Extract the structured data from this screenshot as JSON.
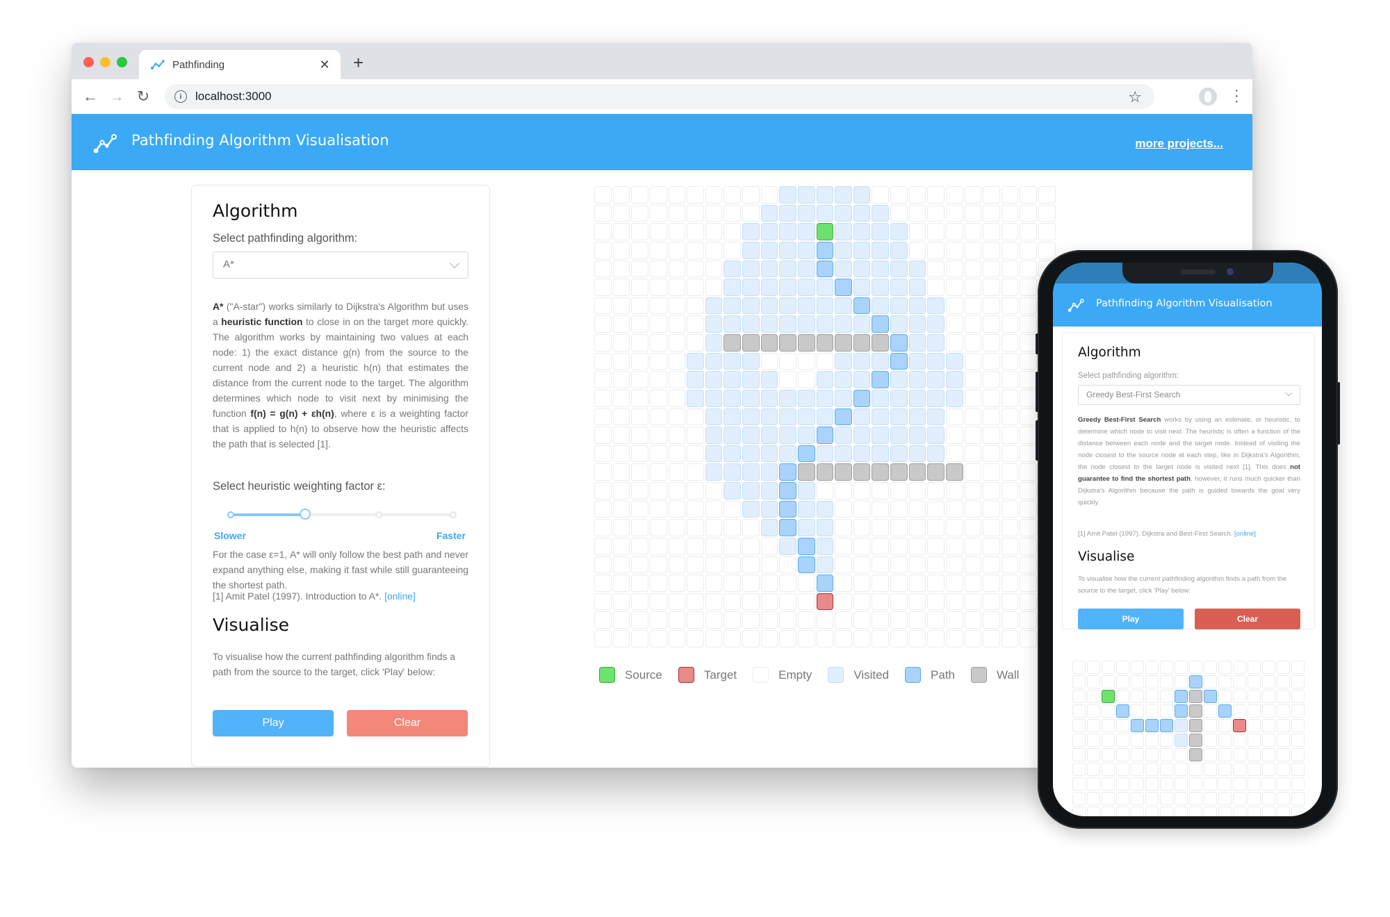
{
  "browser": {
    "tab_title": "Pathfinding",
    "url": "localhost:3000",
    "icons": {
      "back": "arrow-left-icon",
      "forward": "arrow-right-icon",
      "reload": "reload-icon",
      "info": "info-icon",
      "bookmark": "star-icon",
      "profile": "avatar-icon",
      "menu": "kebab-menu-icon",
      "close_tab": "close-icon",
      "new_tab": "plus-icon"
    }
  },
  "header": {
    "title": "Pathfinding Algorithm Visualisation",
    "more_link": "more projects...",
    "brand_color": "#3ba9f5"
  },
  "panel": {
    "algorithm_heading": "Algorithm",
    "select_label": "Select pathfinding algorithm:",
    "selected_algorithm": "A*",
    "description": {
      "bold_name": "A*",
      "part1": " (\"A-star\") works similarly to Dijkstra's Algorithm but uses a ",
      "bold_heuristic": "heuristic function",
      "part2": " to close in on the target more quickly. The algorithm works by maintaining two values at each node: 1) the exact distance g(n) from the source to the current node and 2) a heuristic h(n) that estimates the distance from the current node to the target. The algorithm determines which node to visit next by minimising the function ",
      "bold_formula": "f(n) = g(n) + εh(n)",
      "part3": ", where ε is a weighting factor that is applied to h(n) to observe how the heuristic affects the path that is selected [1]."
    },
    "epsilon_label": "Select heuristic weighting factor ε:",
    "slider": {
      "steps": 4,
      "current_step_index": 1,
      "value_fraction": 0.3333,
      "min_label": "Slower",
      "max_label": "Faster"
    },
    "epsilon_note": "For the case ε=1, A* will only follow the best path and never expand anything else, making it fast while still guaranteeing the shortest path.",
    "reference": "[1] Amit Patel (1997). Introduction to A*. ",
    "reference_link": "[online]",
    "visualise_heading": "Visualise",
    "visualise_desc": "To visualise how the current pathfinding algorithm finds a path from the source to the target, click 'Play' below:",
    "play_label": "Play",
    "clear_label": "Clear"
  },
  "grid": {
    "cols": 25,
    "rows": 25,
    "source": [
      2,
      12
    ],
    "target": [
      22,
      12
    ],
    "visited_ranges": [
      [
        0,
        10,
        14
      ],
      [
        1,
        9,
        15
      ],
      [
        2,
        8,
        16
      ],
      [
        3,
        8,
        16
      ],
      [
        4,
        7,
        17
      ],
      [
        5,
        7,
        17
      ],
      [
        6,
        6,
        18
      ],
      [
        7,
        6,
        18
      ],
      [
        8,
        6,
        6
      ],
      [
        8,
        17,
        18
      ],
      [
        9,
        5,
        8
      ],
      [
        9,
        13,
        15
      ],
      [
        9,
        17,
        19
      ],
      [
        10,
        5,
        9
      ],
      [
        10,
        12,
        14
      ],
      [
        10,
        16,
        19
      ],
      [
        11,
        5,
        19
      ],
      [
        12,
        6,
        18
      ],
      [
        13,
        6,
        18
      ],
      [
        14,
        6,
        18
      ],
      [
        15,
        6,
        9
      ],
      [
        16,
        7,
        9
      ],
      [
        16,
        11,
        11
      ],
      [
        17,
        8,
        9
      ],
      [
        17,
        11,
        12
      ],
      [
        18,
        9,
        9
      ],
      [
        18,
        11,
        12
      ],
      [
        19,
        10,
        10
      ],
      [
        19,
        12,
        12
      ],
      [
        20,
        12,
        12
      ]
    ],
    "path": [
      [
        3,
        12
      ],
      [
        4,
        12
      ],
      [
        5,
        13
      ],
      [
        6,
        14
      ],
      [
        7,
        15
      ],
      [
        8,
        16
      ],
      [
        9,
        16
      ],
      [
        10,
        15
      ],
      [
        11,
        14
      ],
      [
        12,
        13
      ],
      [
        13,
        12
      ],
      [
        14,
        11
      ],
      [
        15,
        10
      ],
      [
        16,
        10
      ],
      [
        17,
        10
      ],
      [
        18,
        10
      ],
      [
        19,
        11
      ],
      [
        20,
        11
      ],
      [
        21,
        12
      ]
    ],
    "walls": [
      [
        8,
        7
      ],
      [
        8,
        8
      ],
      [
        8,
        9
      ],
      [
        8,
        10
      ],
      [
        8,
        11
      ],
      [
        8,
        12
      ],
      [
        8,
        13
      ],
      [
        8,
        14
      ],
      [
        8,
        15
      ],
      [
        15,
        11
      ],
      [
        15,
        12
      ],
      [
        15,
        13
      ],
      [
        15,
        14
      ],
      [
        15,
        15
      ],
      [
        15,
        16
      ],
      [
        15,
        17
      ],
      [
        15,
        18
      ],
      [
        15,
        19
      ]
    ]
  },
  "legend": [
    {
      "label": "Source",
      "type": "source",
      "color": "#6de26f"
    },
    {
      "label": "Target",
      "type": "target",
      "color": "#e88a8a"
    },
    {
      "label": "Empty",
      "type": "empty",
      "color": "#ffffff"
    },
    {
      "label": "Visited",
      "type": "visited",
      "color": "#e1eefd"
    },
    {
      "label": "Path",
      "type": "path",
      "color": "#a9d3fb"
    },
    {
      "label": "Wall",
      "type": "wall",
      "color": "#c9c9c9"
    }
  ],
  "mobile": {
    "title": "Pathfinding Algorithm Visualisation",
    "algorithm_heading": "Algorithm",
    "select_label": "Select pathfinding algorithm:",
    "selected_algorithm": "Greedy Best-First Search",
    "description": {
      "bold_name": "Greedy Best-First Search",
      "part1": " works by using an estimate, or heuristic, to determine which node to visit next. The heuristic is often a function of the distance between each node and the target node. Instead of visiting the node closest to the source node at each step, like in Dijkstra's Algorithm, the node closest to the target node is visited next [1]. This does ",
      "bold_warning": "not guarantee to find the shortest path",
      "part2": ", however, it runs much quicker than Dijkstra's Algorithm because the path is guided towards the goal very quickly."
    },
    "reference": "[1] Amit Patel (1997). Dijkstra and Best-First Search. ",
    "reference_link": "[online]",
    "visualise_heading": "Visualise",
    "visualise_desc": "To visualise how the current pathfinding algorithm finds a path from the source to the target, click 'Play' below:",
    "play_label": "Play",
    "clear_label": "Clear",
    "grid": {
      "cols": 16,
      "rows": 11,
      "source": [
        2,
        2
      ],
      "target": [
        4,
        11
      ],
      "visited": [
        [
          4,
          7
        ],
        [
          5,
          7
        ]
      ],
      "path": [
        [
          1,
          8
        ],
        [
          2,
          7
        ],
        [
          2,
          9
        ],
        [
          3,
          3
        ],
        [
          3,
          7
        ],
        [
          3,
          10
        ],
        [
          4,
          4
        ],
        [
          4,
          5
        ],
        [
          4,
          6
        ]
      ],
      "walls": [
        [
          2,
          8
        ],
        [
          3,
          8
        ],
        [
          4,
          8
        ],
        [
          5,
          8
        ],
        [
          6,
          8
        ]
      ]
    }
  }
}
